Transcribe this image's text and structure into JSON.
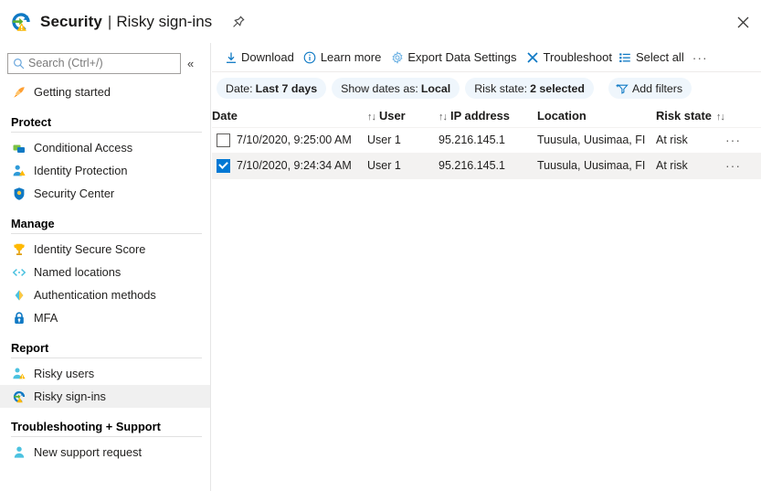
{
  "header": {
    "app_icon": "risky-signin-icon",
    "title": "Security",
    "separator": "|",
    "subtitle": "Risky sign-ins",
    "pin_icon": "pin-icon",
    "close_icon": "close-icon"
  },
  "sidebar": {
    "search": {
      "placeholder": "Search (Ctrl+/)",
      "value": "",
      "icon": "search-icon"
    },
    "collapse_icon": "«",
    "top_items": [
      {
        "label": "Getting started",
        "icon": "rocket-icon"
      }
    ],
    "groups": [
      {
        "title": "Protect",
        "items": [
          {
            "label": "Conditional Access",
            "icon": "conditional-access-icon"
          },
          {
            "label": "Identity Protection",
            "icon": "identity-protection-icon"
          },
          {
            "label": "Security Center",
            "icon": "shield-icon"
          }
        ]
      },
      {
        "title": "Manage",
        "items": [
          {
            "label": "Identity Secure Score",
            "icon": "trophy-icon"
          },
          {
            "label": "Named locations",
            "icon": "code-brackets-icon"
          },
          {
            "label": "Authentication methods",
            "icon": "auth-methods-icon"
          },
          {
            "label": "MFA",
            "icon": "lock-icon"
          }
        ]
      },
      {
        "title": "Report",
        "items": [
          {
            "label": "Risky users",
            "icon": "risky-users-icon"
          },
          {
            "label": "Risky sign-ins",
            "icon": "risky-signin-icon",
            "selected": true
          }
        ]
      },
      {
        "title": "Troubleshooting + Support",
        "items": [
          {
            "label": "New support request",
            "icon": "support-person-icon"
          }
        ]
      }
    ]
  },
  "toolbar": {
    "commands": [
      {
        "label": "Download",
        "icon": "download-icon"
      },
      {
        "label": "Learn more",
        "icon": "info-circle-icon"
      },
      {
        "label": "Export Data Settings",
        "icon": "gear-icon"
      },
      {
        "label": "Troubleshoot",
        "icon": "wrench-cross-icon"
      },
      {
        "label": "Select all",
        "icon": "list-icon"
      }
    ],
    "overflow_label": "···"
  },
  "filters": {
    "pills": [
      {
        "label": "Date:",
        "value": "Last 7 days"
      },
      {
        "label": "Show dates as:",
        "value": "Local"
      },
      {
        "label": "Risk state:",
        "value": "2 selected"
      }
    ],
    "add_filters": {
      "label": "Add filters",
      "icon": "add-filter-icon"
    }
  },
  "table": {
    "columns": [
      {
        "key": "date",
        "label": "Date",
        "sortable": false,
        "sort_icon": ""
      },
      {
        "key": "user",
        "label": "User",
        "sortable": true,
        "sort_icon": "↑↓",
        "sort_position": "before"
      },
      {
        "key": "ip",
        "label": "IP address",
        "sortable": true,
        "sort_icon": "↑↓",
        "sort_position": "before"
      },
      {
        "key": "location",
        "label": "Location",
        "sortable": false,
        "sort_icon": ""
      },
      {
        "key": "risk",
        "label": "Risk state",
        "sortable": true,
        "sort_icon": "↑↓",
        "sort_position": "after"
      }
    ],
    "rows": [
      {
        "selected": false,
        "date": "7/10/2020, 9:25:00 AM",
        "user": "User 1",
        "ip": "95.216.145.1",
        "location": "Tuusula, Uusimaa, FI",
        "risk": "At risk",
        "menu": "···"
      },
      {
        "selected": true,
        "date": "7/10/2020, 9:24:34 AM",
        "user": "User 1",
        "ip": "95.216.145.1",
        "location": "Tuusula, Uusimaa, FI",
        "risk": "At risk",
        "menu": "···"
      }
    ]
  },
  "colors": {
    "accent": "#0078d4",
    "pill_bg": "#eff6fc",
    "selected_row": "#f3f2f1",
    "selected_nav": "#f0f0f0",
    "risk_orange": "#ffaa44",
    "green": "#5bb12f"
  }
}
